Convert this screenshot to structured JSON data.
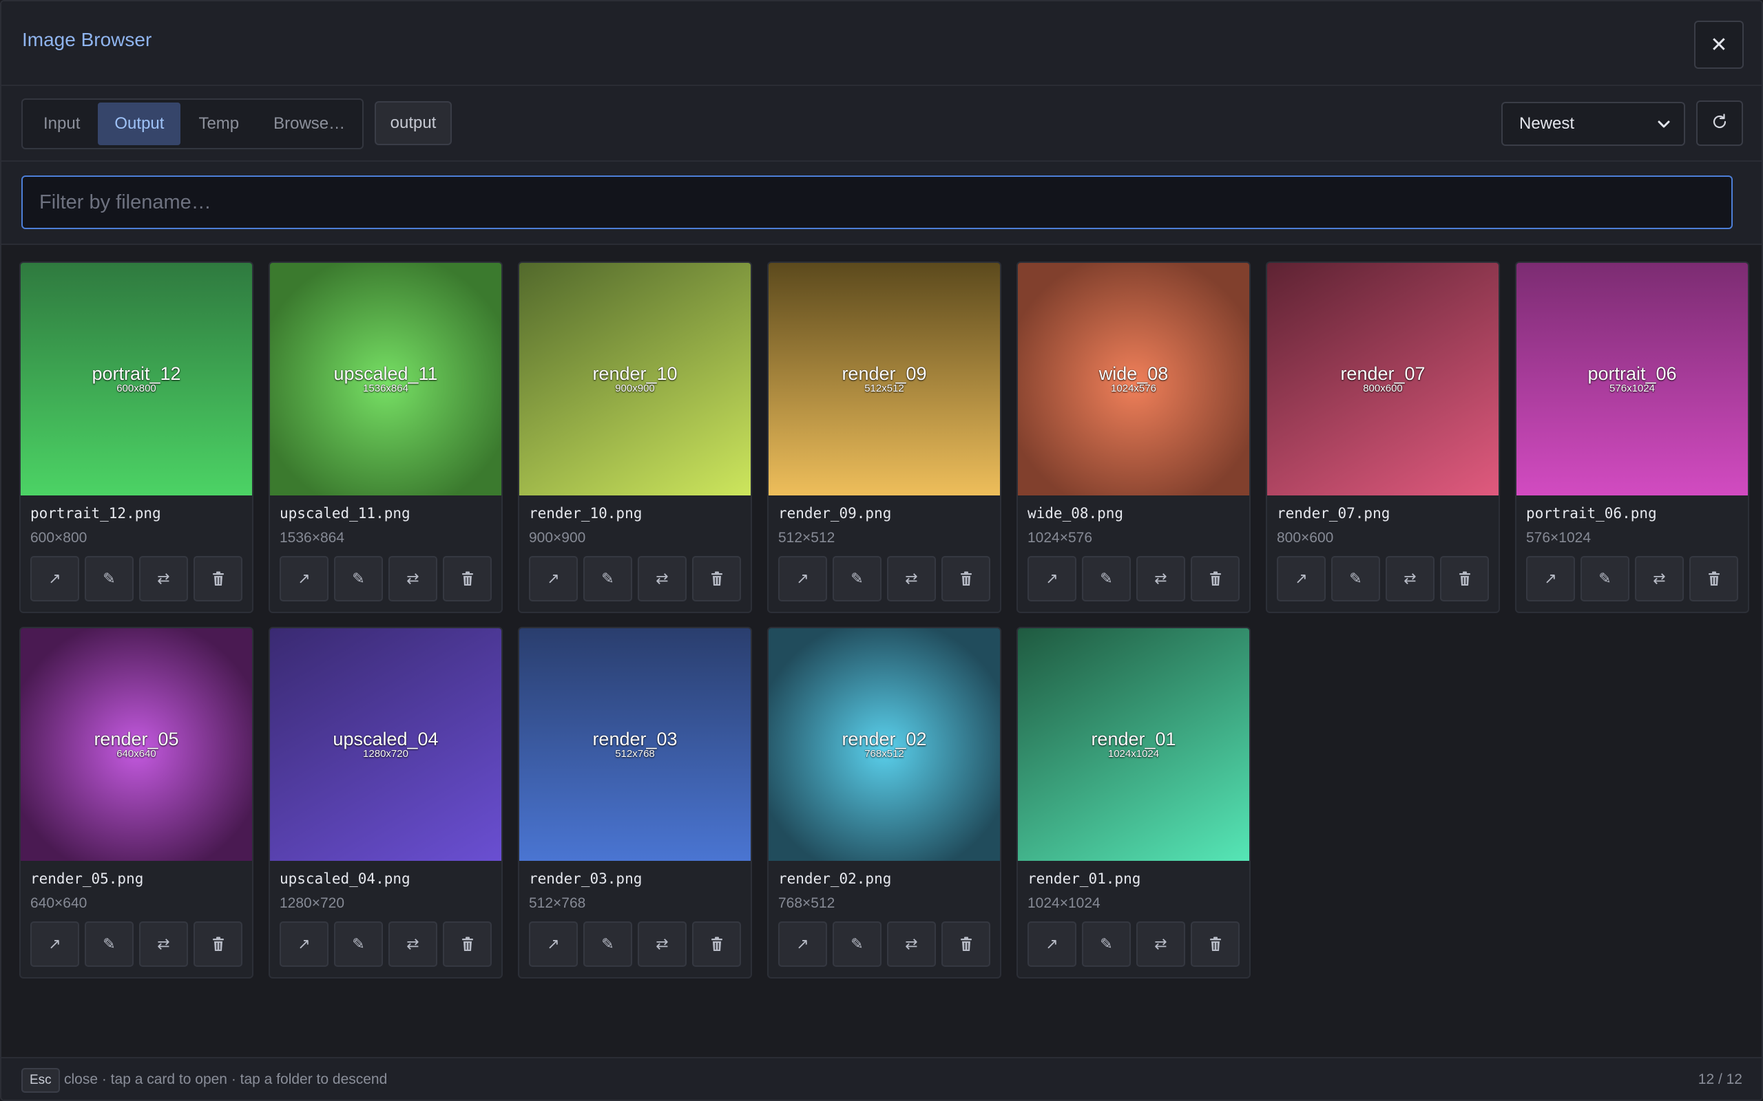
{
  "header": {
    "title": "Image Browser",
    "close_label": "✕"
  },
  "toolbar": {
    "tabs": [
      {
        "label": "Input",
        "active": false
      },
      {
        "label": "Output",
        "active": true
      },
      {
        "label": "Temp",
        "active": false
      },
      {
        "label": "Browse…",
        "active": false
      }
    ],
    "path": "output",
    "sort": {
      "selected": "Newest"
    }
  },
  "filter": {
    "placeholder": "Filter by filename…",
    "value": ""
  },
  "items": [
    {
      "name": "portrait_12",
      "file": "portrait_12.png",
      "dims": "600×800",
      "thumb_dims": "600x800",
      "colors": [
        "#2f7a3f",
        "#4cd365"
      ],
      "style": "linear-down"
    },
    {
      "name": "upscaled_11",
      "file": "upscaled_11.png",
      "dims": "1536×864",
      "thumb_dims": "1536x864",
      "colors": [
        "#77e065",
        "#3b7a2e"
      ],
      "style": "radial"
    },
    {
      "name": "render_10",
      "file": "render_10.png",
      "dims": "900×900",
      "thumb_dims": "900x900",
      "colors": [
        "#52692c",
        "#cde65d"
      ],
      "style": "linear-diag"
    },
    {
      "name": "render_09",
      "file": "render_09.png",
      "dims": "512×512",
      "thumb_dims": "512x512",
      "colors": [
        "#5c4a1d",
        "#eebe5b"
      ],
      "style": "linear-down"
    },
    {
      "name": "wide_08",
      "file": "wide_08.png",
      "dims": "1024×576",
      "thumb_dims": "1024x576",
      "colors": [
        "#f0805a",
        "#81402d"
      ],
      "style": "radial"
    },
    {
      "name": "render_07",
      "file": "render_07.png",
      "dims": "800×600",
      "thumb_dims": "800x600",
      "colors": [
        "#5e2333",
        "#e05a7e"
      ],
      "style": "linear-diag"
    },
    {
      "name": "portrait_06",
      "file": "portrait_06.png",
      "dims": "576×1024",
      "thumb_dims": "576x1024",
      "colors": [
        "#7c2c72",
        "#d24bc1"
      ],
      "style": "linear-down"
    },
    {
      "name": "render_05",
      "file": "render_05.png",
      "dims": "640×640",
      "thumb_dims": "640x640",
      "colors": [
        "#c45ae0",
        "#4a1a52"
      ],
      "style": "radial"
    },
    {
      "name": "upscaled_04",
      "file": "upscaled_04.png",
      "dims": "1280×720",
      "thumb_dims": "1280x720",
      "colors": [
        "#3a2a72",
        "#6a4fd2"
      ],
      "style": "linear-diag"
    },
    {
      "name": "render_03",
      "file": "render_03.png",
      "dims": "512×768",
      "thumb_dims": "512x768",
      "colors": [
        "#2a3e6e",
        "#4a75d2"
      ],
      "style": "linear-down"
    },
    {
      "name": "render_02",
      "file": "render_02.png",
      "dims": "768×512",
      "thumb_dims": "768x512",
      "colors": [
        "#5ad0ec",
        "#214c5c"
      ],
      "style": "radial"
    },
    {
      "name": "render_01",
      "file": "render_01.png",
      "dims": "1024×1024",
      "thumb_dims": "1024x1024",
      "colors": [
        "#1f5a40",
        "#56e6b6"
      ],
      "style": "linear-diag"
    }
  ],
  "actions": [
    {
      "name": "open",
      "icon": "open-icon",
      "glyph": "↗"
    },
    {
      "name": "edit",
      "icon": "pencil-icon",
      "glyph": "✎"
    },
    {
      "name": "swap",
      "icon": "swap-icon",
      "glyph": "⇄"
    },
    {
      "name": "delete",
      "icon": "trash-icon",
      "glyph": "🗑"
    }
  ],
  "footer": {
    "key": "Esc",
    "hint": "close · tap a card to open · tap a folder to descend",
    "count": "12 / 12"
  },
  "colors": {
    "accent": "#4d7fd8",
    "title": "#8fb4ee",
    "active_tab_bg": "#36456a"
  }
}
